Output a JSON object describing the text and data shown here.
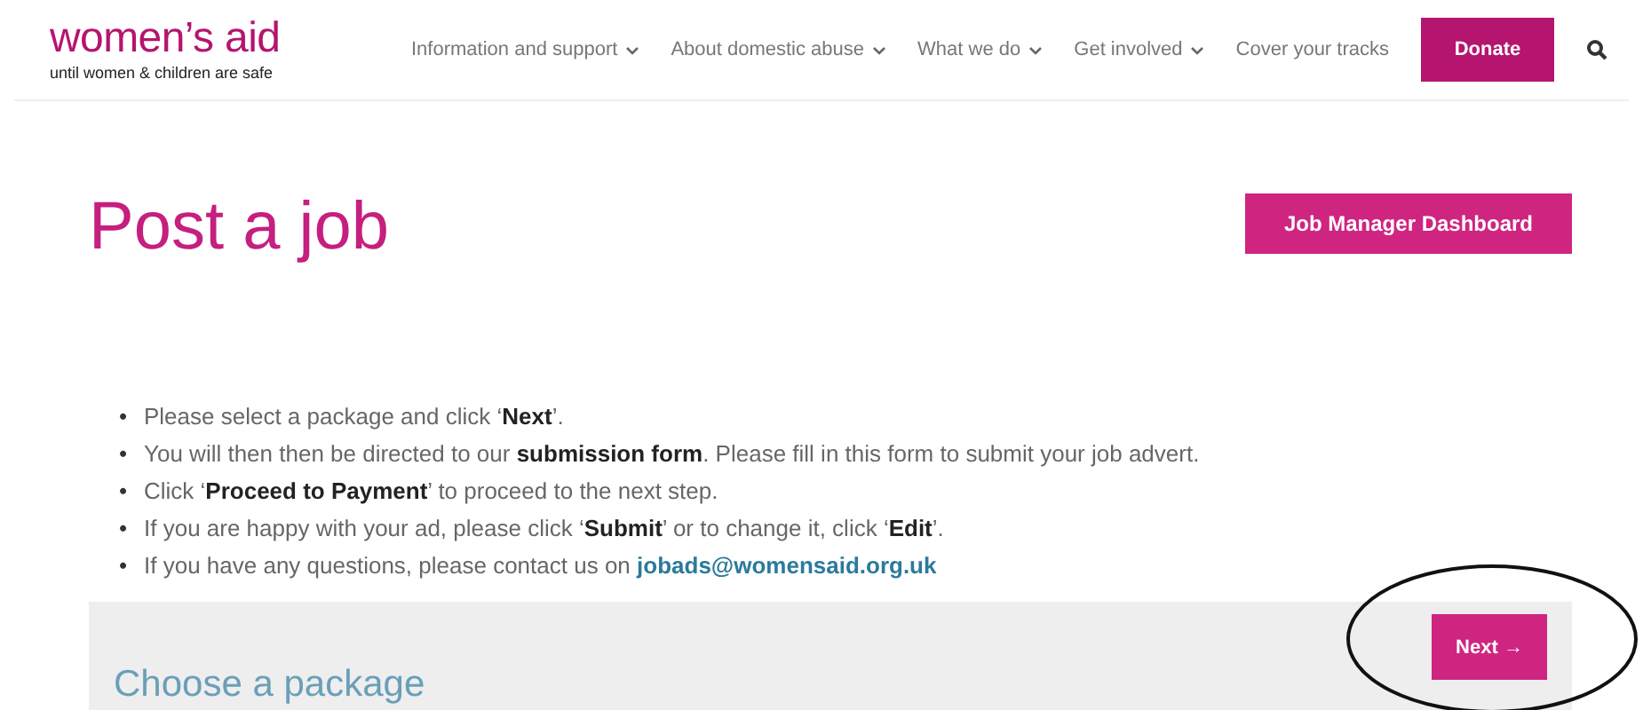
{
  "logo": {
    "name": "women’s aid",
    "tagline": "until women & children are safe"
  },
  "nav": [
    {
      "label": "Information and support",
      "dropdown": true
    },
    {
      "label": "About domestic abuse",
      "dropdown": true
    },
    {
      "label": "What we do",
      "dropdown": true
    },
    {
      "label": "Get involved",
      "dropdown": true
    },
    {
      "label": "Cover your tracks",
      "dropdown": false
    }
  ],
  "donate": "Donate",
  "title": "Post a job",
  "dashboard_button": "Job Manager Dashboard",
  "instructions": [
    {
      "bullet": "•",
      "text": "Please select a package and click ‘**Next**’."
    },
    {
      "bullet": "•",
      "text": "You will then then be directed to our **submission form**. Please fill in this form to submit your job advert."
    },
    {
      "bullet": "•",
      "text": "Click ‘**Proceed to Payment**’ to proceed to the next step."
    },
    {
      "bullet": "•",
      "text": "If you are happy with your ad, please click ‘**Submit**’ or to change it, click ‘**Edit**’."
    },
    {
      "bullet": "•",
      "text": "If you have any questions, please contact us on",
      "link": "jobads@womensaid.org.uk"
    }
  ],
  "package_panel": {
    "heading": "Choose a package",
    "next_button": "Next →"
  }
}
